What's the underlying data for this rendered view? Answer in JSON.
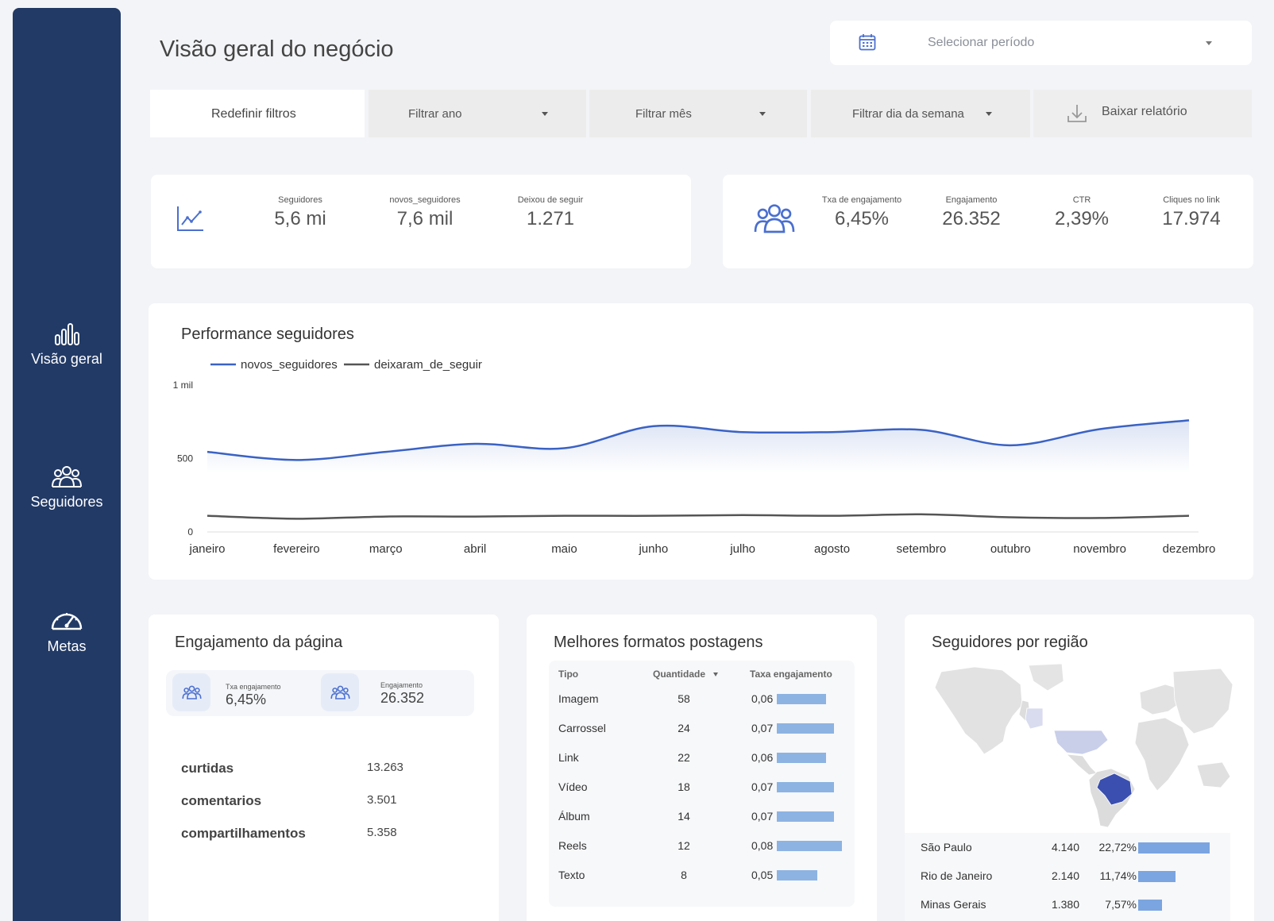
{
  "sidebar": {
    "items": [
      {
        "label": "Visão geral",
        "icon": "bar-chart-icon"
      },
      {
        "label": "Seguidores",
        "icon": "users-icon"
      },
      {
        "label": "Metas",
        "icon": "gauge-icon"
      }
    ]
  },
  "header": {
    "title": "Visão geral do negócio",
    "period_placeholder": "Selecionar período"
  },
  "filters": {
    "reset": "Redefinir filtros",
    "year": "Filtrar ano",
    "month": "Filtrar mês",
    "weekday": "Filtrar dia da semana",
    "download": "Baixar relatório"
  },
  "kpis_followers": [
    {
      "label": "Seguidores",
      "value": "5,6 mi"
    },
    {
      "label": "novos_seguidores",
      "value": "7,6 mil"
    },
    {
      "label": "Deixou de seguir",
      "value": "1.271"
    }
  ],
  "kpis_engagement": [
    {
      "label": "Txa de engajamento",
      "value": "6,45%"
    },
    {
      "label": "Engajamento",
      "value": "26.352"
    },
    {
      "label": "CTR",
      "value": "2,39%"
    },
    {
      "label": "Cliques no link",
      "value": "17.974"
    }
  ],
  "performance": {
    "title": "Performance seguidores"
  },
  "chart_data": {
    "type": "line",
    "x": [
      "janeiro",
      "fevereiro",
      "março",
      "abril",
      "maio",
      "junho",
      "julho",
      "agosto",
      "setembro",
      "outubro",
      "novembro",
      "dezembro"
    ],
    "series": [
      {
        "name": "novos_seguidores",
        "values": [
          545,
          490,
          545,
          600,
          570,
          720,
          680,
          680,
          695,
          590,
          700,
          760
        ],
        "color": "#3a62c4"
      },
      {
        "name": "deixaram_de_seguir",
        "values": [
          110,
          90,
          105,
          105,
          110,
          110,
          115,
          110,
          120,
          100,
          95,
          110
        ],
        "color": "#555555"
      }
    ],
    "yticks": [
      {
        "value": 0,
        "label": "0"
      },
      {
        "value": 500,
        "label": "500"
      },
      {
        "value": 1000,
        "label": "1 mil"
      }
    ],
    "ylim": [
      0,
      1000
    ],
    "legend": "top-left"
  },
  "engagement_page": {
    "title": "Engajamento da página",
    "rate_label": "Txa engajamento",
    "rate_value": "6,45%",
    "eng_label": "Engajamento",
    "eng_value": "26.352",
    "metrics": [
      {
        "label": "curtidas",
        "value": "13.263"
      },
      {
        "label": "comentarios",
        "value": "3.501"
      },
      {
        "label": "compartilhamentos",
        "value": "5.358"
      }
    ]
  },
  "formats": {
    "title": "Melhores formatos postagens",
    "headers": {
      "type": "Tipo",
      "qty": "Quantidade",
      "rate": "Taxa engajamento"
    },
    "rows": [
      {
        "type": "Imagem",
        "qty": "58",
        "rate": "0,06",
        "rate_value": 0.06
      },
      {
        "type": "Carrossel",
        "qty": "24",
        "rate": "0,07",
        "rate_value": 0.07
      },
      {
        "type": "Link",
        "qty": "22",
        "rate": "0,06",
        "rate_value": 0.06
      },
      {
        "type": "Vídeo",
        "qty": "18",
        "rate": "0,07",
        "rate_value": 0.07
      },
      {
        "type": "Álbum",
        "qty": "14",
        "rate": "0,07",
        "rate_value": 0.07
      },
      {
        "type": "Reels",
        "qty": "12",
        "rate": "0,08",
        "rate_value": 0.08
      },
      {
        "type": "Texto",
        "qty": "8",
        "rate": "0,05",
        "rate_value": 0.05
      }
    ]
  },
  "regions": {
    "title": "Seguidores por região",
    "rows": [
      {
        "name": "São Paulo",
        "count": "4.140",
        "pct": "22,72%",
        "pct_value": 22.72
      },
      {
        "name": "Rio de Janeiro",
        "count": "2.140",
        "pct": "11,74%",
        "pct_value": 11.74
      },
      {
        "name": "Minas Gerais",
        "count": "1.380",
        "pct": "7,57%",
        "pct_value": 7.57
      }
    ]
  }
}
